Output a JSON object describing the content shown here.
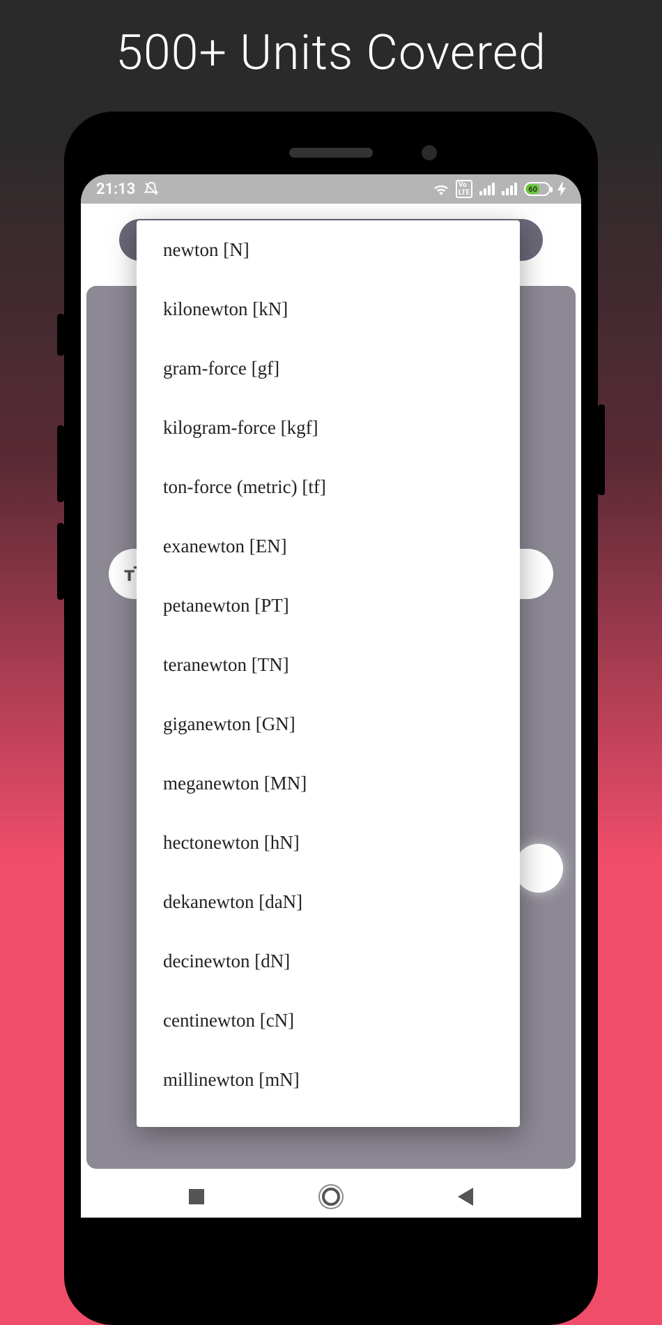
{
  "headline": "500+ Units Covered",
  "status": {
    "time": "21:13",
    "battery_pct": "60"
  },
  "pill_icon_text": "тT",
  "units": [
    "newton [N]",
    "kilonewton [kN]",
    "gram-force [gf]",
    "kilogram-force [kgf]",
    "ton-force (metric) [tf]",
    "exanewton [EN]",
    "petanewton [PT]",
    "teranewton [TN]",
    "giganewton [GN]",
    "meganewton [MN]",
    "hectonewton [hN]",
    "dekanewton [daN]",
    "decinewton [dN]",
    "centinewton [cN]",
    "millinewton [mN]"
  ]
}
